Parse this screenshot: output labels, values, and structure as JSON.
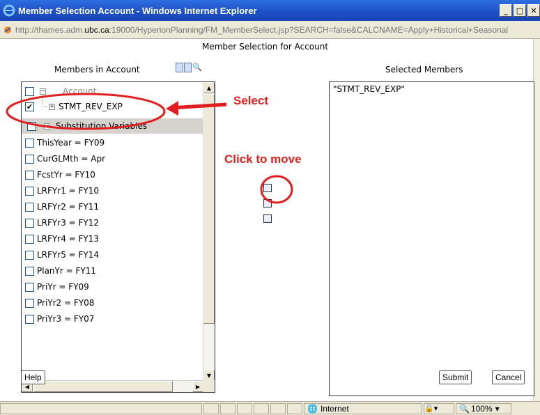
{
  "window": {
    "title": "Member Selection Account - Windows Internet Explorer",
    "address_url_prefix": "http://thames.adm.",
    "address_url_domain": "ubc.ca",
    "address_url_suffix": ":19000/HyperionPlanning/FM_MemberSelect.jsp?SEARCH=false&CALCNAME=Apply+Historical+Seasonal"
  },
  "page": {
    "title": "Member Selection for Account",
    "left_title": "Members in Account",
    "right_title": "Selected Members"
  },
  "tree": {
    "root_label": "Account",
    "stmt_label": "STMT_REV_EXP",
    "subvar_label": "Substitution Variables",
    "items": [
      "ThisYear = FY09",
      "CurGLMth = Apr",
      "FcstYr = FY10",
      "LRFYr1 = FY10",
      "LRFYr2 = FY11",
      "LRFYr3 = FY12",
      "LRFYr4 = FY13",
      "LRFYr5 = FY14",
      "PlanYr = FY11",
      "PriYr = FY09",
      "PriYr2 = FY08",
      "PriYr3 = FY07"
    ]
  },
  "selected": {
    "items": [
      "\"STMT_REV_EXP\""
    ]
  },
  "buttons": {
    "help": "Help",
    "submit": "Submit",
    "cancel": "Cancel"
  },
  "annotations": {
    "select": "Select",
    "click_to_move": "Click to move",
    "color": "#e02020"
  },
  "status": {
    "zone": "Internet",
    "zoom": "100%"
  }
}
